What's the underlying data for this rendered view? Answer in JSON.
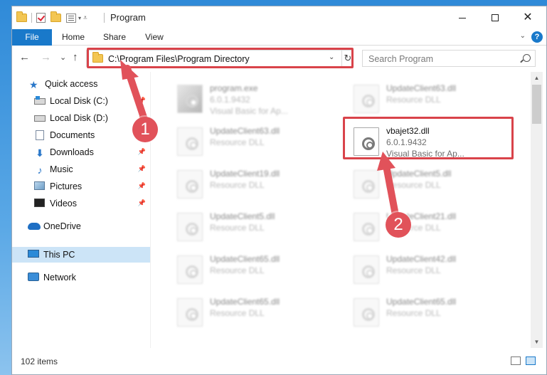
{
  "window": {
    "title": "Program"
  },
  "ribbon": {
    "tabs": [
      {
        "label": "File"
      },
      {
        "label": "Home"
      },
      {
        "label": "Share"
      },
      {
        "label": "View"
      }
    ],
    "help": "?"
  },
  "navbar": {
    "back": "←",
    "forward": "→",
    "recent": "⌄",
    "up": "↑",
    "address": "C:\\Program Files\\Program Directory",
    "search_placeholder": "Search Program"
  },
  "sidebar": {
    "items": [
      {
        "label": "Quick access"
      },
      {
        "label": "Local Disk (C:)"
      },
      {
        "label": "Local Disk (D:)"
      },
      {
        "label": "Documents"
      },
      {
        "label": "Downloads"
      },
      {
        "label": "Music"
      },
      {
        "label": "Pictures"
      },
      {
        "label": "Videos"
      },
      {
        "label": "OneDrive"
      },
      {
        "label": "This PC"
      },
      {
        "label": "Network"
      }
    ]
  },
  "files": [
    {
      "name": "program.exe",
      "line1": "6.0.1.9432",
      "line2": "Visual Basic for Ap..."
    },
    {
      "name": "UpdateClient63.dll",
      "line1": "Resource DLL",
      "line2": ""
    },
    {
      "name": "UpdateClient63.dll",
      "line1": "Resource DLL",
      "line2": ""
    },
    {
      "name": "vbajet32.dll",
      "line1": "6.0.1.9432",
      "line2": "Visual Basic for Ap..."
    },
    {
      "name": "UpdateClient19.dll",
      "line1": "Resource DLL",
      "line2": ""
    },
    {
      "name": "UpdateClient5.dll",
      "line1": "Resource DLL",
      "line2": ""
    },
    {
      "name": "UpdateClient5.dll",
      "line1": "Resource DLL",
      "line2": ""
    },
    {
      "name": "UpdateClient21.dll",
      "line1": "Resource DLL",
      "line2": ""
    },
    {
      "name": "UpdateClient65.dll",
      "line1": "Resource DLL",
      "line2": ""
    },
    {
      "name": "UpdateClient42.dll",
      "line1": "Resource DLL",
      "line2": ""
    },
    {
      "name": "UpdateClient65.dll",
      "line1": "Resource DLL",
      "line2": ""
    },
    {
      "name": "UpdateClient65.dll",
      "line1": "Resource DLL",
      "line2": ""
    }
  ],
  "status": {
    "item_count": "102 items"
  },
  "annotations": {
    "marker1": "1",
    "marker2": "2",
    "color": "#d9434a"
  }
}
